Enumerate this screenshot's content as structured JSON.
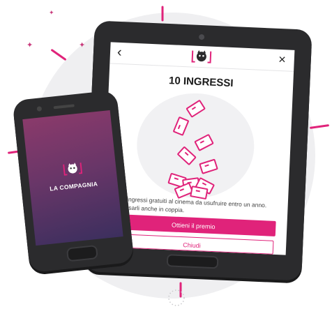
{
  "colors": {
    "accent": "#e0237a",
    "device_body": "#2b2b2d",
    "background_circle": "#efeff1",
    "phone_gradient_top": "#8a3a6b",
    "phone_gradient_bottom": "#3c2f5e"
  },
  "tablet": {
    "header": {
      "back_icon": "chevron-left-icon",
      "back_glyph": "‹",
      "logo_icon": "cat-mask-logo-icon",
      "close_icon": "close-icon",
      "close_glyph": "×"
    },
    "title": "10 INGRESSI",
    "illustration_icon": "tickets-icon",
    "description": "Dieci ingressi gratuiti al cinema da usufruire entro un anno. Puoi usarli anche in coppia.",
    "primary_button": "Ottieni il premio",
    "secondary_button": "Chiudi"
  },
  "phone": {
    "logo_icon": "cat-mask-logo-icon",
    "brand": "LA COMPAGNIA"
  }
}
